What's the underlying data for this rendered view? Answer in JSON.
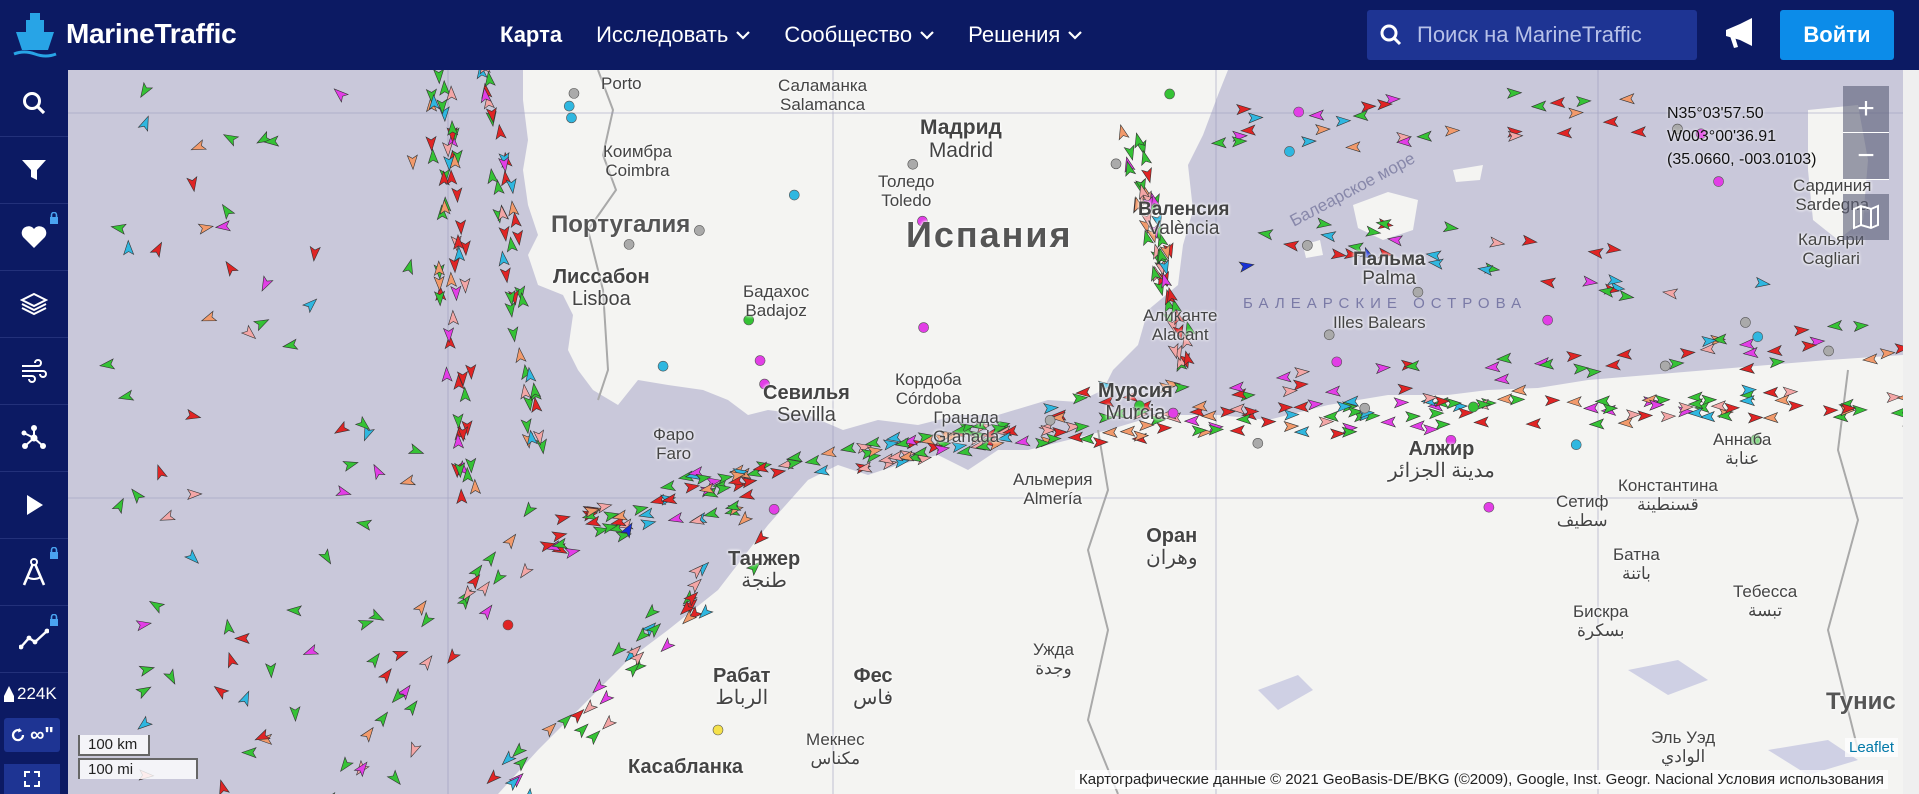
{
  "header": {
    "logo_text": "MarineTraffic",
    "nav": [
      {
        "label": "Карта",
        "active": true,
        "dropdown": false
      },
      {
        "label": "Исследовать",
        "active": false,
        "dropdown": true
      },
      {
        "label": "Сообщество",
        "active": false,
        "dropdown": true
      },
      {
        "label": "Решения",
        "active": false,
        "dropdown": true
      }
    ],
    "search_placeholder": "Поиск на MarineTraffic",
    "login_label": "Войти"
  },
  "sidebar": {
    "items": [
      {
        "icon": "search-icon",
        "locked": false
      },
      {
        "icon": "filter-icon",
        "locked": false
      },
      {
        "icon": "heart-icon",
        "locked": true
      },
      {
        "icon": "layers-icon",
        "locked": false
      },
      {
        "icon": "wind-icon",
        "locked": false
      },
      {
        "icon": "network-icon",
        "locked": false
      },
      {
        "icon": "play-icon",
        "locked": false
      },
      {
        "icon": "compass-icon",
        "locked": true
      },
      {
        "icon": "chart-line-icon",
        "locked": true
      }
    ],
    "vessel_count": "224K",
    "loop_label": "∞\""
  },
  "map": {
    "cursor_coords": {
      "lat": "N35°03'57.50",
      "lon": "W003°00'36.91",
      "decimal": "(35.0660, -003.0103)"
    },
    "zoom_in": "+",
    "zoom_out": "−",
    "labels": {
      "porto": "Porto",
      "salamanca_ru": "Саламанка",
      "salamanca": "Salamanca",
      "madrid_ru": "Мадрид",
      "madrid": "Madrid",
      "coimbra_ru": "Коимбра",
      "coimbra": "Coimbra",
      "toledo_ru": "Толедо",
      "toledo": "Toledo",
      "portugal": "Португалия",
      "spain": "Испания",
      "valencia_ru": "Валенсия",
      "valencia": "València",
      "balearic_sea": "Балеарское море",
      "lisbon_ru": "Лиссабон",
      "lisbon": "Lisboa",
      "badajoz_ru": "Бадахос",
      "badajoz": "Badajoz",
      "palma_ru": "Пальма",
      "palma": "Palma",
      "balearic_islands_ru": "БАЛЕАРСКИЕ ОСТРОВА",
      "balearic_islands": "Illes Balears",
      "alicante_ru": "Аликанте",
      "alicante": "Alacant",
      "cordoba_ru": "Кордоба",
      "cordoba": "Córdoba",
      "sevilla_ru": "Севилья",
      "sevilla": "Sevilla",
      "murcia_ru": "Мурсия",
      "murcia": "Murcia",
      "granada_ru": "Гранада",
      "granada": "Granada",
      "faro_ru": "Фаро",
      "faro": "Faro",
      "almeria_ru": "Альмерия",
      "almeria": "Almería",
      "tangier_ru": "Танжер",
      "tangier_ar": "طنجة",
      "oran_ru": "Оран",
      "oran_ar": "وهران",
      "algiers_ru": "Алжир",
      "algiers_ar": "مدينة الجزائر",
      "annaba_ru": "Аннаба",
      "annaba_ar": "عنابة",
      "setif_ru": "Сетиф",
      "setif_ar": "سطيف",
      "constantine_ru": "Константина",
      "constantine_ar": "قسنطينة",
      "batna_ru": "Батна",
      "batna_ar": "باتنة",
      "tebessa_ru": "Тебесса",
      "tebessa_ar": "تبسة",
      "biskra_ru": "Бискра",
      "biskra_ar": "بسكرة",
      "oujda_ru": "Ужда",
      "oujda_ar": "وجدة",
      "rabat_ru": "Рабат",
      "rabat_ar": "الرباط",
      "fes_ru": "Фес",
      "fes_ar": "فاس",
      "meknes_ru": "Мекнес",
      "meknes_ar": "مكناس",
      "casablanca_ru": "Касабланка",
      "tunisia_ru": "Тунис",
      "eloued_ru": "Эль Уэд",
      "eloued_ar": "الوادي",
      "sardinia_ru": "Сардиния",
      "sardinia": "Sardegna",
      "cagliari_ru": "Кальяри",
      "cagliari": "Cagliari"
    },
    "scale_km": "100 km",
    "scale_mi": "100 mi",
    "attribution": "Картографические данные © 2021 GeoBasis-DE/BKG (©2009), Google, Inst. Geogr. Nacional    Условия использования",
    "leaflet": "Leaflet",
    "colors": {
      "cargo": "#35c235",
      "tanker": "#e02424",
      "passenger": "#2fb7e0",
      "tug": "#f29a6b",
      "pleasure": "#e23ee6",
      "fishing": "#f3a6a6",
      "unknown": "#aaaaaa",
      "hsc": "#f5e14b",
      "navy": "#1730d6"
    }
  }
}
